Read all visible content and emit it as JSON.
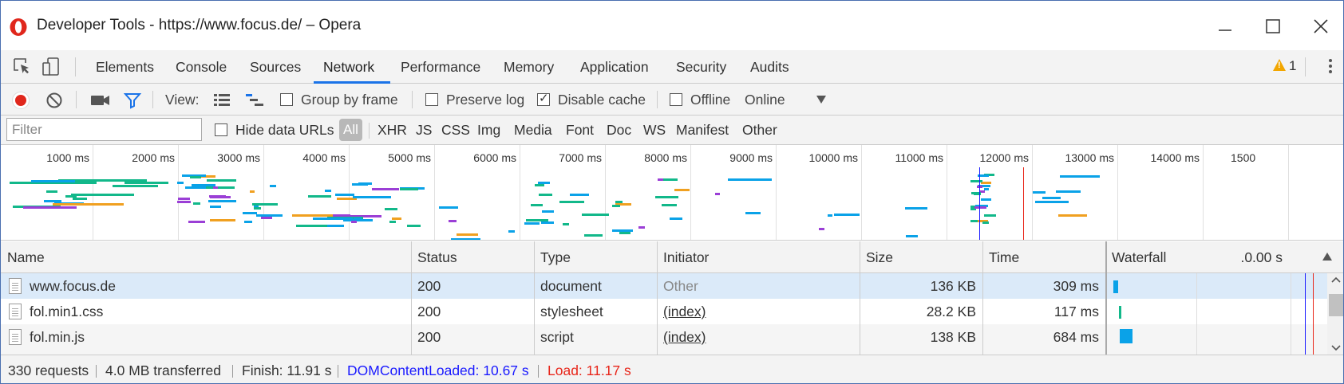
{
  "window": {
    "title": "Developer Tools - https://www.focus.de/ – Opera"
  },
  "tabs": [
    {
      "label": "Elements"
    },
    {
      "label": "Console"
    },
    {
      "label": "Sources"
    },
    {
      "label": "Network",
      "active": true
    },
    {
      "label": "Performance"
    },
    {
      "label": "Memory"
    },
    {
      "label": "Application"
    },
    {
      "label": "Security"
    },
    {
      "label": "Audits"
    }
  ],
  "warnings": {
    "count": "1"
  },
  "toolbar": {
    "view_label": "View:",
    "group_by_frame": {
      "label": "Group by frame",
      "checked": false
    },
    "preserve_log": {
      "label": "Preserve log",
      "checked": false
    },
    "disable_cache": {
      "label": "Disable cache",
      "checked": true
    },
    "offline": {
      "label": "Offline",
      "checked": false
    },
    "throttling": "Online"
  },
  "filterbar": {
    "placeholder": "Filter",
    "hide_data_urls": {
      "label": "Hide data URLs",
      "checked": false
    },
    "types": [
      "All",
      "XHR",
      "JS",
      "CSS",
      "Img",
      "Media",
      "Font",
      "Doc",
      "WS",
      "Manifest",
      "Other"
    ]
  },
  "overview": {
    "ticks": [
      "1000 ms",
      "2000 ms",
      "3000 ms",
      "4000 ms",
      "5000 ms",
      "6000 ms",
      "7000 ms",
      "8000 ms",
      "9000 ms",
      "10000 ms",
      "11000 ms",
      "12000 ms",
      "13000 ms",
      "14000 ms",
      "1500"
    ]
  },
  "table": {
    "columns": {
      "name": "Name",
      "status": "Status",
      "type": "Type",
      "initiator": "Initiator",
      "size": "Size",
      "time": "Time",
      "waterfall": "Waterfall",
      "waterfall_time": ".0.00 s"
    },
    "rows": [
      {
        "name": "www.focus.de",
        "status": "200",
        "type": "document",
        "initiator": "Other",
        "size": "136 KB",
        "time": "309 ms"
      },
      {
        "name": "fol.min1.css",
        "status": "200",
        "type": "stylesheet",
        "initiator": "(index)",
        "size": "28.2 KB",
        "time": "117 ms"
      },
      {
        "name": "fol.min.js",
        "status": "200",
        "type": "script",
        "initiator": "(index)",
        "size": "138 KB",
        "time": "684 ms"
      }
    ]
  },
  "status": {
    "requests": "330 requests",
    "transferred": "4.0 MB transferred",
    "finish": "Finish: 11.91 s",
    "dom_content_loaded": "DOMContentLoaded: 10.67 s",
    "load": "Load: 11.17 s"
  },
  "colors": {
    "accent": "#1a73e8",
    "record": "#e0271c",
    "dcl": "#1a1aff",
    "load": "#e8261a"
  }
}
